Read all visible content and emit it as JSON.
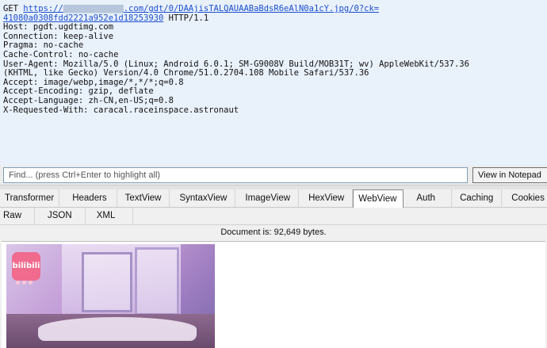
{
  "request": {
    "method": "GET",
    "url_prefix": "https://",
    "url_blurred": "████████████",
    "url_rest": ".com/gdt/0/DAAjisTALQAUAABaBdsR6eAlN0a1cY.jpg/0?ck=",
    "url_line2": "41080a0308fdd2221a952e1d18253930",
    "protocol": " HTTP/1.1",
    "headers": [
      "Host: pgdt.ugdtimg.com",
      "Connection: keep-alive",
      "Pragma: no-cache",
      "Cache-Control: no-cache",
      "User-Agent: Mozilla/5.0 (Linux; Android 6.0.1; SM-G9008V Build/MOB31T; wv) AppleWebKit/537.36",
      "(KHTML, like Gecko) Version/4.0 Chrome/51.0.2704.108 Mobile Safari/537.36",
      "Accept: image/webp,image/*,*/*;q=0.8",
      "Accept-Encoding: gzip, deflate",
      "Accept-Language: zh-CN,en-US;q=0.8",
      "X-Requested-With: caracal.raceinspace.astronaut"
    ]
  },
  "find": {
    "placeholder": "Find... (press Ctrl+Enter to highlight all)",
    "view_button": "View in Notepad"
  },
  "tabs_row1": [
    "Transformer",
    "Headers",
    "TextView",
    "SyntaxView",
    "ImageView",
    "HexView",
    "WebView",
    "Auth",
    "Caching",
    "Cookies"
  ],
  "selected_tab": "WebView",
  "tabs_row2": [
    "Raw",
    "JSON",
    "XML"
  ],
  "document_info": "Document is: 92,649 bytes.",
  "image": {
    "logo_text": "bilibili"
  }
}
